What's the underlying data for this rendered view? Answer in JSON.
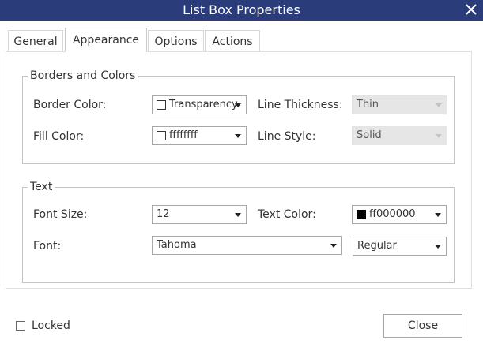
{
  "window": {
    "title": "List Box Properties"
  },
  "tabs": [
    {
      "label": "General"
    },
    {
      "label": "Appearance"
    },
    {
      "label": "Options"
    },
    {
      "label": "Actions"
    }
  ],
  "borders_colors": {
    "legend": "Borders and Colors",
    "border_color_label": "Border Color:",
    "border_color_value": "Transparency",
    "fill_color_label": "Fill Color:",
    "fill_color_value": "ffffffff",
    "line_thickness_label": "Line Thickness:",
    "line_thickness_value": "Thin",
    "line_style_label": "Line Style:",
    "line_style_value": "Solid"
  },
  "text_group": {
    "legend": "Text",
    "font_size_label": "Font Size:",
    "font_size_value": "12",
    "text_color_label": "Text Color:",
    "text_color_value": "ff000000",
    "font_label": "Font:",
    "font_value": "Tahoma",
    "font_style_value": "Regular"
  },
  "footer": {
    "locked_label": "Locked",
    "close_label": "Close"
  },
  "colors": {
    "titlebar": "#2b3c7a",
    "border_color_swatch": "#ffffff",
    "fill_color_swatch": "#ffffff",
    "text_color_swatch": "#000000"
  },
  "icons": {
    "close": "x",
    "dropdown": "chevron-down",
    "checkbox": "unchecked-box"
  }
}
